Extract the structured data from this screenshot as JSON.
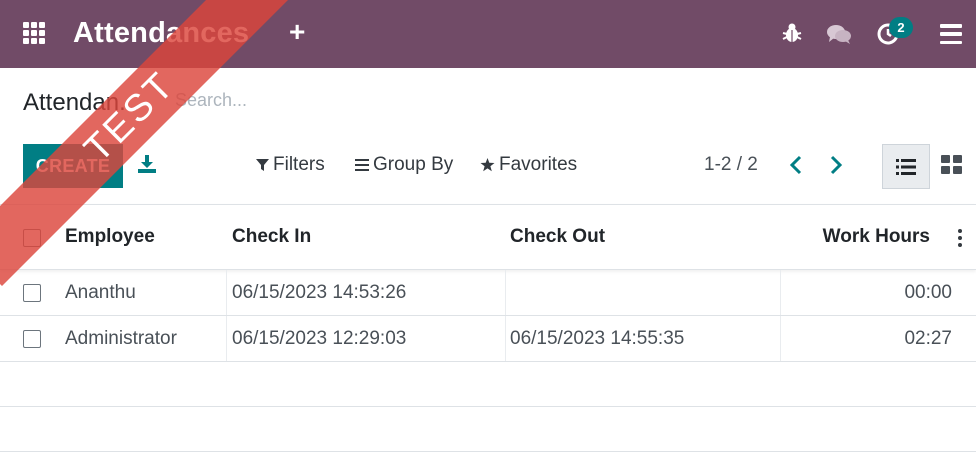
{
  "navbar": {
    "app_title": "Attendances",
    "activity_badge": "2",
    "background": "#714B67"
  },
  "control_panel": {
    "breadcrumb": "Attendan...",
    "search_placeholder": "Search...",
    "create_label": "CREATE",
    "filters_label": "Filters",
    "groupby_label": "Group By",
    "favorites_label": "Favorites",
    "pager": "1-2 / 2",
    "accent": "#017E84"
  },
  "table": {
    "headers": {
      "employee": "Employee",
      "check_in": "Check In",
      "check_out": "Check Out",
      "work_hours": "Work Hours"
    },
    "rows": [
      {
        "employee": "Ananthu",
        "check_in": "06/15/2023 14:53:26",
        "check_out": "",
        "work_hours": "00:00"
      },
      {
        "employee": "Administrator",
        "check_in": "06/15/2023 12:29:03",
        "check_out": "06/15/2023 14:55:35",
        "work_hours": "02:27"
      }
    ]
  },
  "ribbon": {
    "label": "TEST",
    "color": "#DC463C"
  },
  "icons": [
    "apps-grid-icon",
    "plus-icon",
    "bug-icon",
    "chat-icon",
    "activity-clock-icon",
    "hamburger-menu-icon",
    "download-icon",
    "filter-icon",
    "group-by-icon",
    "star-icon",
    "chevron-left-icon",
    "chevron-right-icon",
    "list-view-icon",
    "kanban-view-icon",
    "optional-columns-icon"
  ]
}
